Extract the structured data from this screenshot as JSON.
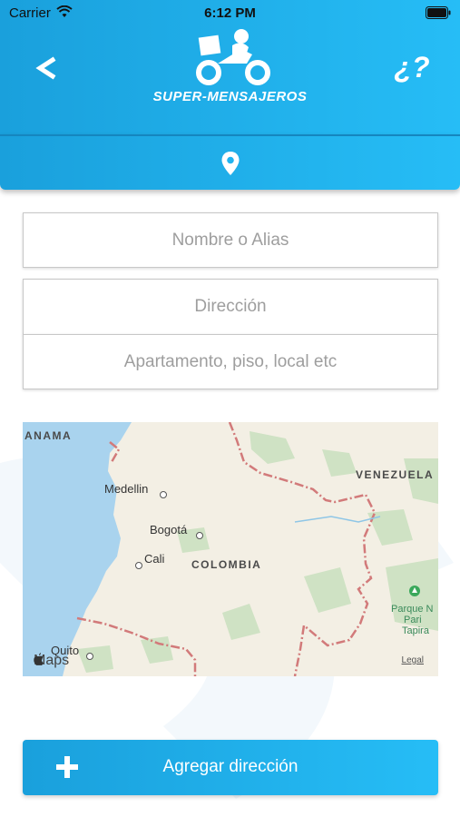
{
  "status_bar": {
    "carrier": "Carrier",
    "time": "6:12 PM"
  },
  "header": {
    "brand": "SUPER-MENSAJEROS",
    "help_label": "¿?",
    "back_icon": "chevron-left-icon",
    "pin_icon": "location-pin-icon"
  },
  "form": {
    "nombre_placeholder": "Nombre o Alias",
    "direccion_placeholder": "Dirección",
    "apartamento_placeholder": "Apartamento, piso, local etc"
  },
  "map": {
    "labels": {
      "panama": "ANAMA",
      "venezuela": "VENEZUELA",
      "colombia": "COLOMBIA",
      "medellin": "Medellin",
      "bogota": "Bogotá",
      "cali": "Cali",
      "quito": "Quito",
      "park_line1": "Parque N",
      "park_line2": "Pari",
      "park_line3": "Tapira"
    },
    "brand": "Maps",
    "legal": "Legal"
  },
  "actions": {
    "add_address": "Agregar dirección"
  },
  "colors": {
    "primary_start": "#1aa0dc",
    "primary_end": "#26bdf6",
    "sea": "#a9d3ee",
    "land": "#f3efe4",
    "border": "#d27a7a"
  }
}
